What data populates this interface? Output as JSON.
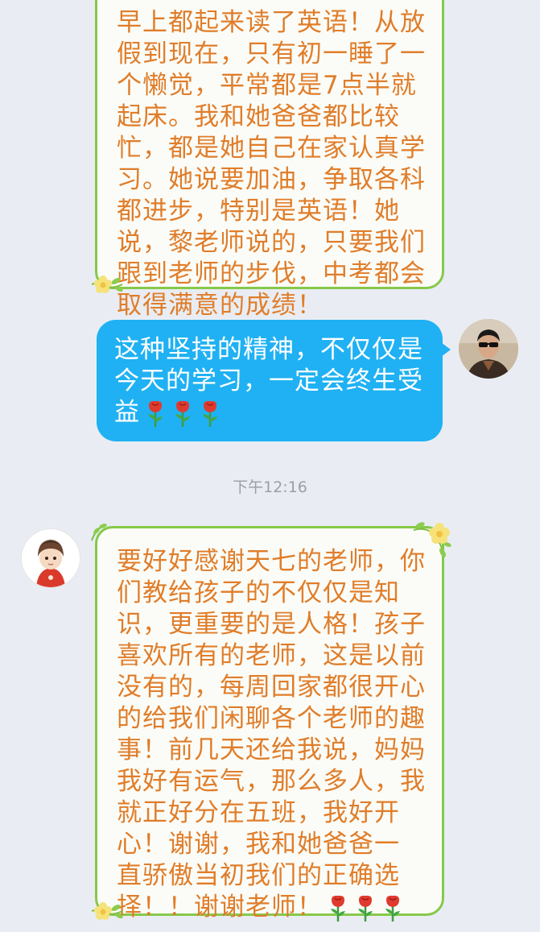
{
  "messages": [
    {
      "direction": "incoming",
      "lines": [
        "早上都起来读了英语！从放",
        "假到现在，只有初一睡了一",
        "个懒觉，平常都是7点半就",
        "起床。我和她爸爸都比较",
        "忙，都是她自己在家认真学",
        "习。她说要加油，争取各科",
        "都进步，特别是英语！她",
        "说，黎老师说的，只要我们",
        "跟到老师的步伐，中考都会",
        "取得满意的成绩！"
      ]
    },
    {
      "direction": "outgoing",
      "lines": [
        "这种坚持的精神，不仅仅是",
        "今天的学习，一定会终生受",
        "益"
      ],
      "emoji": [
        "rose-icon",
        "rose-icon",
        "rose-icon"
      ]
    },
    {
      "direction": "incoming",
      "lines": [
        "要好好感谢天七的老师，你",
        "们教给孩子的不仅仅是知",
        "识，更重要的是人格！孩子",
        "喜欢所有的老师，这是以前",
        "没有的，每周回家都很开心",
        "的给我们闲聊各个老师的趣",
        "事！前几天还给我说，妈妈",
        "我好有运气，那么多人，我",
        "就正好分在五班，我好开",
        "心！谢谢，我和她爸爸一",
        "直骄傲当初我们的正确选",
        "择！！谢谢老师！"
      ],
      "emoji": [
        "rose-icon",
        "rose-icon",
        "rose-icon"
      ]
    }
  ],
  "timestamp": "下午12:16",
  "colors": {
    "background": "#e9edf3",
    "incoming_text": "#e07d2a",
    "incoming_border": "#86c94a",
    "outgoing_bubble": "#1fb1f3",
    "timestamp_text": "#9a9ea6"
  }
}
